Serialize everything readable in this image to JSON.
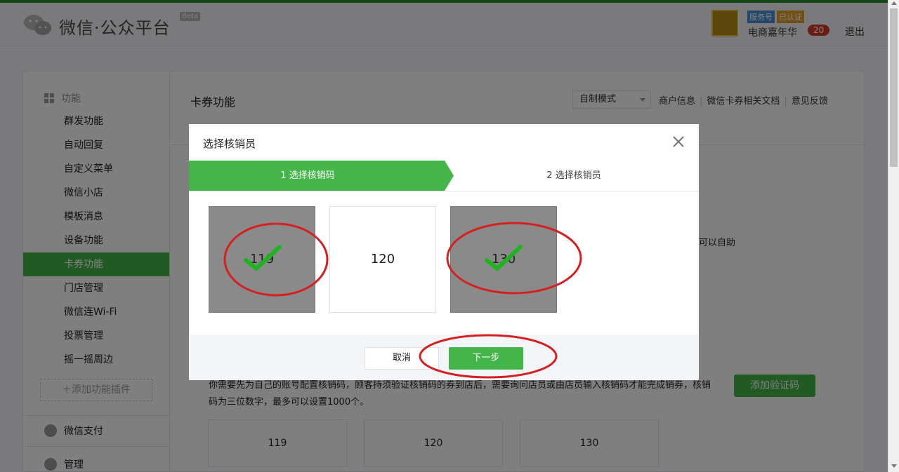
{
  "header": {
    "brand": "微信·公众平台",
    "beta": "Beta",
    "badge_service": "服务号",
    "badge_verified": "已认证",
    "account_name": "电商嘉年华",
    "notification_count": "20",
    "logout": "退出"
  },
  "sidebar": {
    "section_title": "功能",
    "items": [
      {
        "label": "群发功能"
      },
      {
        "label": "自动回复"
      },
      {
        "label": "自定义菜单"
      },
      {
        "label": "微信小店"
      },
      {
        "label": "模板消息"
      },
      {
        "label": "设备功能"
      },
      {
        "label": "卡券功能"
      },
      {
        "label": "门店管理"
      },
      {
        "label": "微信连Wi-Fi"
      },
      {
        "label": "投票管理"
      },
      {
        "label": "摇一摇周边"
      }
    ],
    "active_item": "卡券功能",
    "add_plugin": "添加功能插件",
    "pay_section": "微信支付",
    "manage_section": "管理"
  },
  "main": {
    "title": "卡券功能",
    "mode_select": "自制模式",
    "links": [
      "商户信息",
      "微信卡券相关文档",
      "意见反馈"
    ],
    "partial_text": "可以自助",
    "description": "你需要先为自己的账号配置核销码，顾客持须验证核销码的券到店后，需要询问店员或由店员输入核销码才能完成销券，核销码为三位数字，最多可以设置1000个。",
    "add_code_button": "添加验证码",
    "codes": [
      "119",
      "120",
      "130"
    ]
  },
  "dialog": {
    "title": "选择核销员",
    "steps": [
      {
        "label": "1 选择核销码",
        "active": true
      },
      {
        "label": "2 选择核销员",
        "active": false
      }
    ],
    "codes": [
      {
        "value": "119",
        "selected": true
      },
      {
        "value": "120",
        "selected": false
      },
      {
        "value": "130",
        "selected": true
      }
    ],
    "cancel": "取消",
    "next": "下一步"
  },
  "colors": {
    "accent": "#44b549",
    "annotation": "#d42020",
    "check": "#1fb31f"
  }
}
